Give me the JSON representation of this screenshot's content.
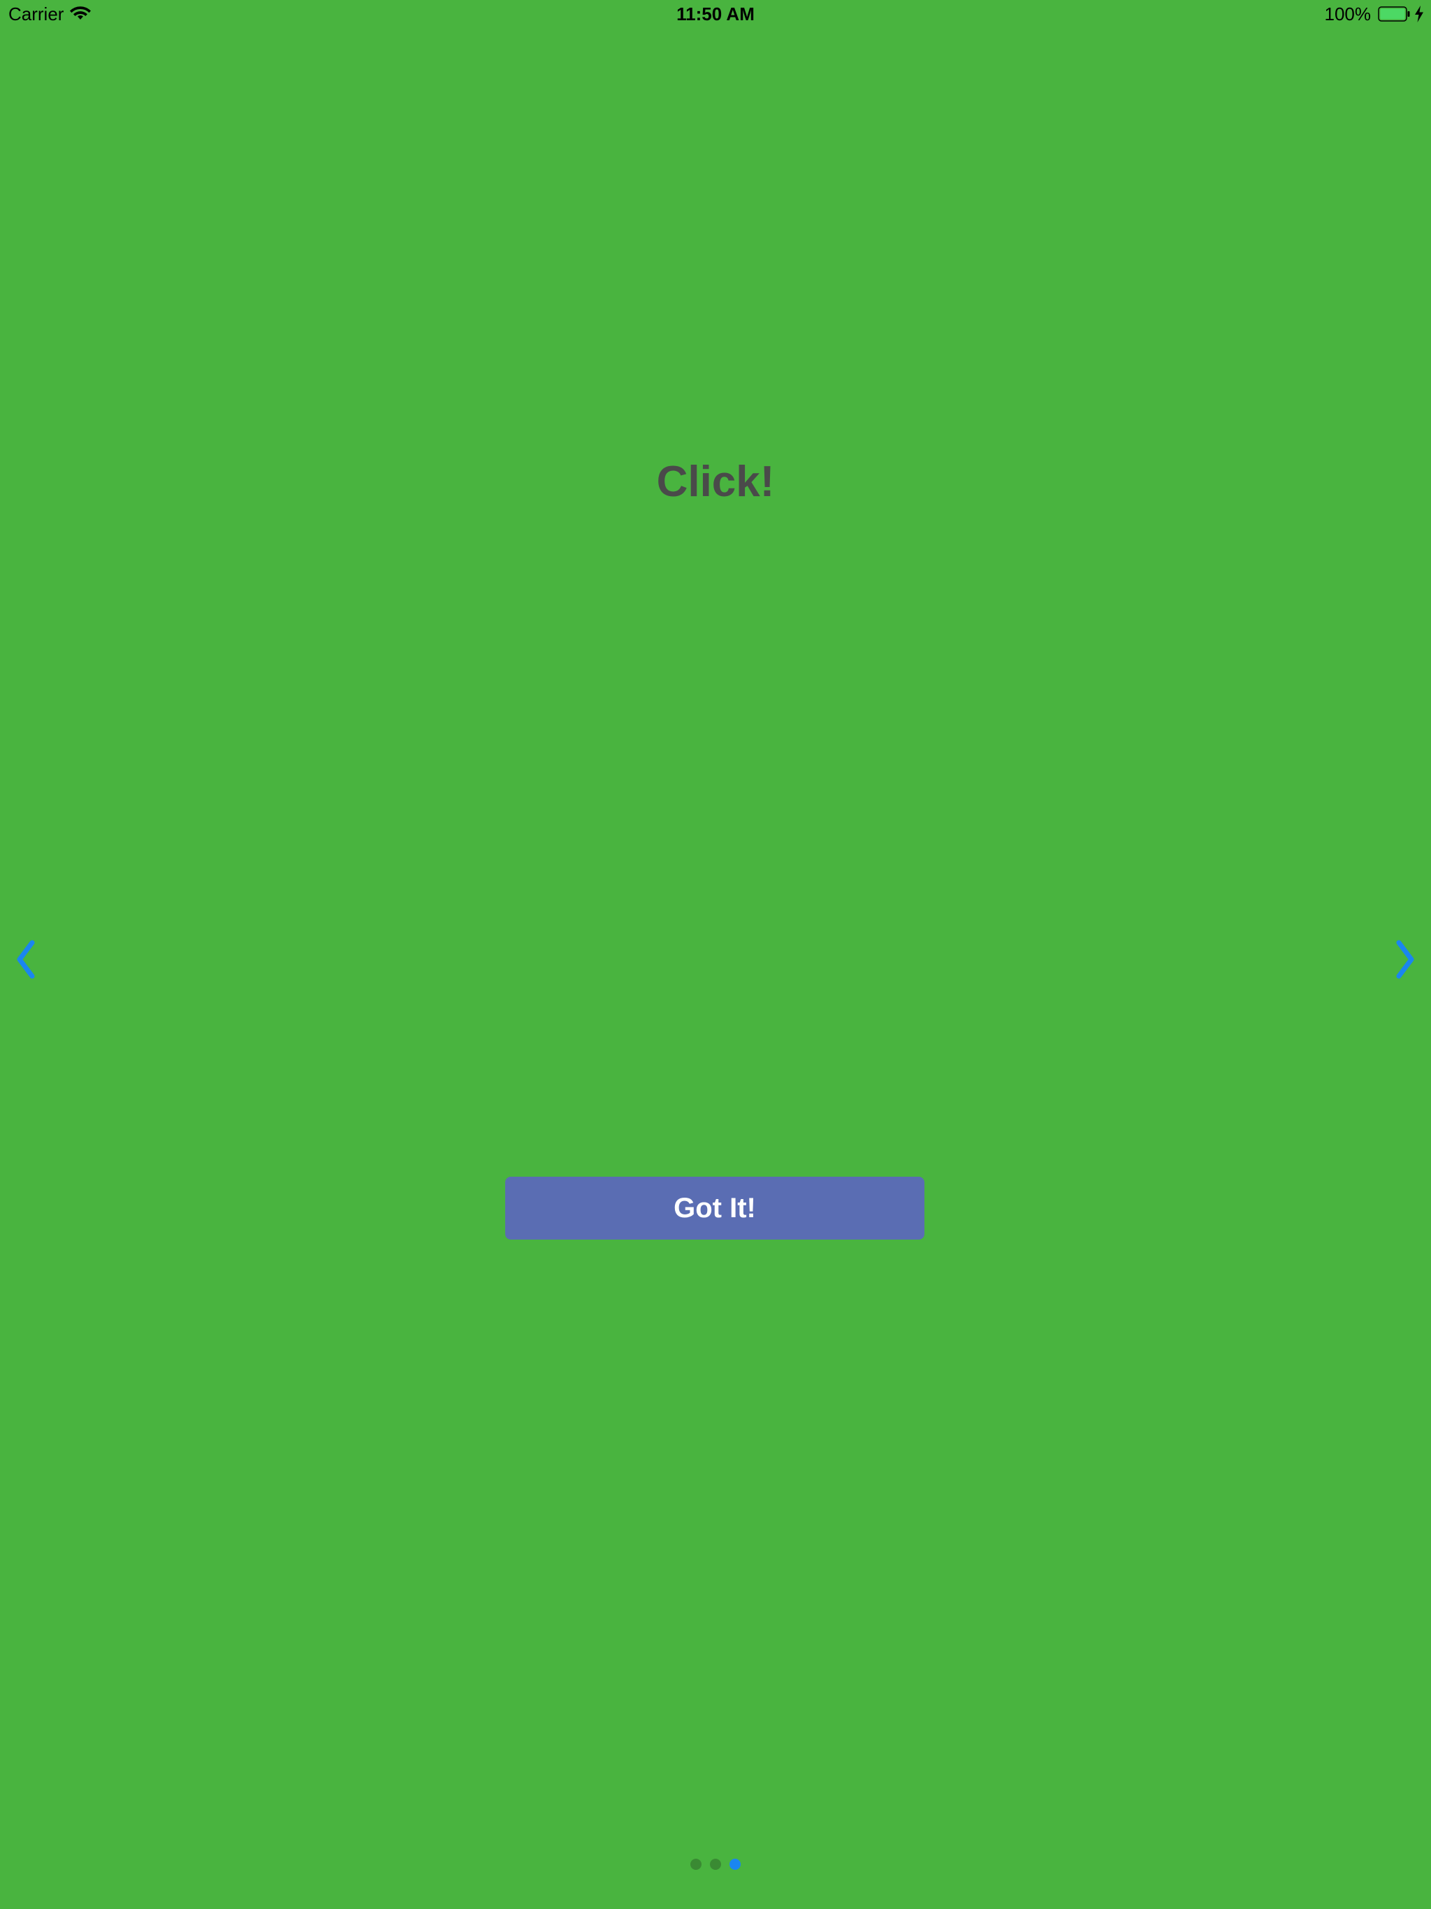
{
  "status_bar": {
    "carrier": "Carrier",
    "time": "11:50 AM",
    "battery_percent": "100%",
    "wifi_icon": "wifi-icon",
    "battery_icon": "battery-full-icon",
    "charging_icon": "charging-bolt-icon"
  },
  "onboarding": {
    "headline": "Click!",
    "button_label": "Got It!",
    "prev_icon": "chevron-left-icon",
    "next_icon": "chevron-right-icon",
    "page_count": 3,
    "current_page": 3
  },
  "colors": {
    "background": "#49b43f",
    "headline_text": "#4a4a4a",
    "button_background": "#5a6db3",
    "button_text": "#ffffff",
    "nav_arrow": "#1a86f0",
    "page_dot_active": "#1a86f0",
    "page_dot_inactive": "#3a8a33"
  }
}
